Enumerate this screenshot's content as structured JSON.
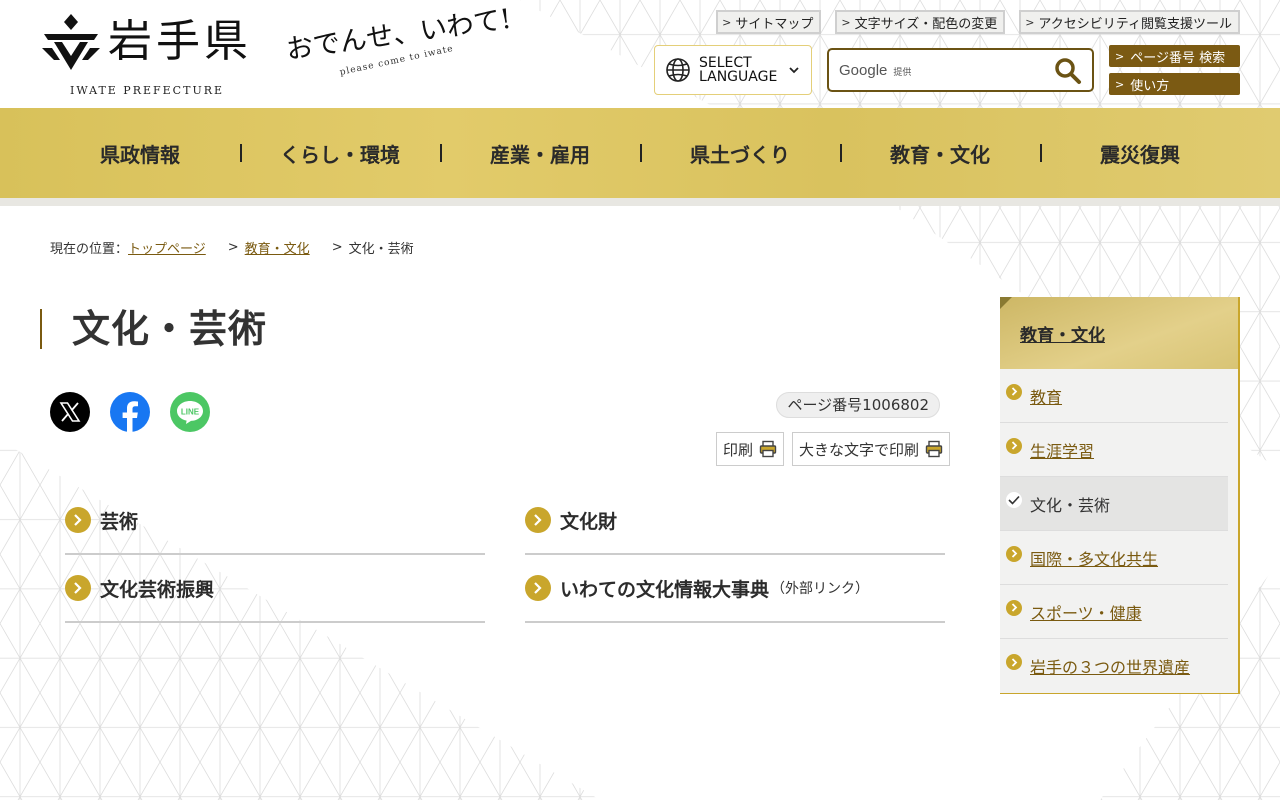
{
  "header": {
    "logo_title": "岩手県",
    "logo_sub": "IWATE PREFECTURE",
    "catch_main": "おでんせ、いわて!",
    "catch_sub": "please come to iwate",
    "util_links": [
      "サイトマップ",
      "文字サイズ・配色の変更",
      "アクセシビリティ閲覧支援ツール"
    ],
    "lang_line1": "SELECT",
    "lang_line2": "LANGUAGE",
    "search_google": "Google",
    "search_provided": "提供",
    "search_value": "",
    "side_buttons": [
      "ページ番号 検索",
      "使い方"
    ]
  },
  "gnav": [
    "県政情報",
    "くらし・環境",
    "産業・雇用",
    "県土づくり",
    "教育・文化",
    "震災復興"
  ],
  "breadcrumb": {
    "label": "現在の位置：",
    "links": [
      "トップページ",
      "教育・文化"
    ],
    "current": "文化・芸術",
    "sep": ">"
  },
  "main": {
    "title": "文化・芸術",
    "page_number": "ページ番号1006802",
    "print_label": "印刷",
    "print_large_label": "大きな文字で印刷",
    "categories": [
      {
        "label": "芸術",
        "ext": ""
      },
      {
        "label": "文化財",
        "ext": ""
      },
      {
        "label": "文化芸術振興",
        "ext": ""
      },
      {
        "label": "いわての文化情報大事典",
        "ext": "（外部リンク）"
      }
    ]
  },
  "sns": {
    "x": "x-icon",
    "facebook": "facebook-icon",
    "line": "line-icon",
    "line_text": "LINE"
  },
  "sidebar": {
    "heading": "教育・文化",
    "items": [
      "教育",
      "生涯学習",
      "文化・芸術",
      "国際・多文化共生",
      "スポーツ・健康",
      "岩手の３つの世界遺産"
    ],
    "current_index": 2
  },
  "colors": {
    "gold": "#c9a62c",
    "brown": "#7a5a10",
    "nav_gold": "#dcc462"
  }
}
